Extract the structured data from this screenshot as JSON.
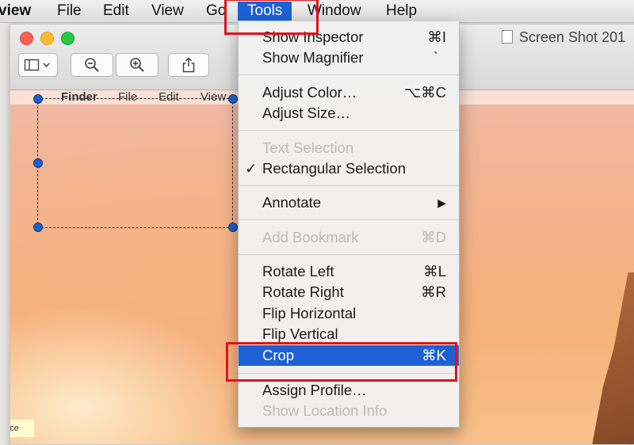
{
  "menubar": {
    "app_name": "view",
    "file": "File",
    "edit": "Edit",
    "view": "View",
    "go": "Go",
    "tools": "Tools",
    "window": "Window",
    "help": "Help"
  },
  "window": {
    "title": "Screen Shot 201"
  },
  "canvas": {
    "menu_finder": "Finder",
    "menu_file": "File",
    "menu_edit": "Edit",
    "menu_view": "View",
    "face_label": "face"
  },
  "tools_menu": {
    "show_inspector": {
      "label": "Show Inspector",
      "shortcut": "⌘I"
    },
    "show_magnifier": {
      "label": "Show Magnifier",
      "shortcut": "`"
    },
    "adjust_color": {
      "label": "Adjust Color…",
      "shortcut": "⌥⌘C"
    },
    "adjust_size": {
      "label": "Adjust Size…",
      "shortcut": ""
    },
    "text_selection": {
      "label": "Text Selection",
      "shortcut": ""
    },
    "rectangular_selection": {
      "label": "Rectangular Selection",
      "shortcut": "",
      "check": "✓"
    },
    "annotate": {
      "label": "Annotate",
      "shortcut": "▶"
    },
    "add_bookmark": {
      "label": "Add Bookmark",
      "shortcut": "⌘D"
    },
    "rotate_left": {
      "label": "Rotate Left",
      "shortcut": "⌘L"
    },
    "rotate_right": {
      "label": "Rotate Right",
      "shortcut": "⌘R"
    },
    "flip_horizontal": {
      "label": "Flip Horizontal",
      "shortcut": ""
    },
    "flip_vertical": {
      "label": "Flip Vertical",
      "shortcut": ""
    },
    "crop": {
      "label": "Crop",
      "shortcut": "⌘K"
    },
    "assign_profile": {
      "label": "Assign Profile…",
      "shortcut": ""
    },
    "show_location_info": {
      "label": "Show Location Info",
      "shortcut": ""
    }
  },
  "colors": {
    "highlight": "#1e60d6",
    "annotation_red": "#e0131b",
    "handle_blue": "#1f62c6"
  }
}
